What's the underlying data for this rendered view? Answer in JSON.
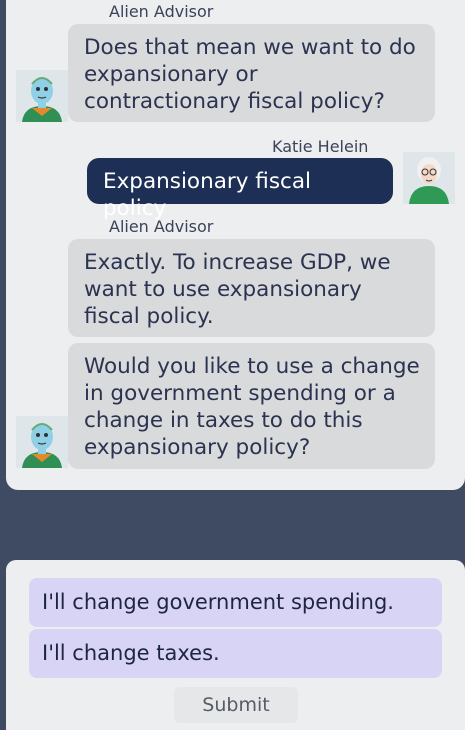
{
  "chat": {
    "messages": [
      {
        "sender": "Alien Advisor",
        "text": "Does that mean we want to do expansionary or contractionary fiscal policy?"
      },
      {
        "sender": "Katie Helein",
        "text": "Expansionary fiscal policy"
      },
      {
        "sender": "Alien Advisor",
        "text": "Exactly.  To increase GDP, we want to use expansionary fiscal policy."
      },
      {
        "sender": "",
        "text": "Would you like to use a change in government spending or a change in taxes to do this expansionary policy?"
      }
    ]
  },
  "answers": {
    "options": [
      "I'll change government spending.",
      "I'll change taxes."
    ],
    "submit_label": "Submit"
  },
  "colors": {
    "background": "#3f4a63",
    "panel": "#eceeef",
    "advisor_bubble": "#d9dadb",
    "user_bubble": "#1e2f55",
    "option": "#d8d4f5"
  }
}
